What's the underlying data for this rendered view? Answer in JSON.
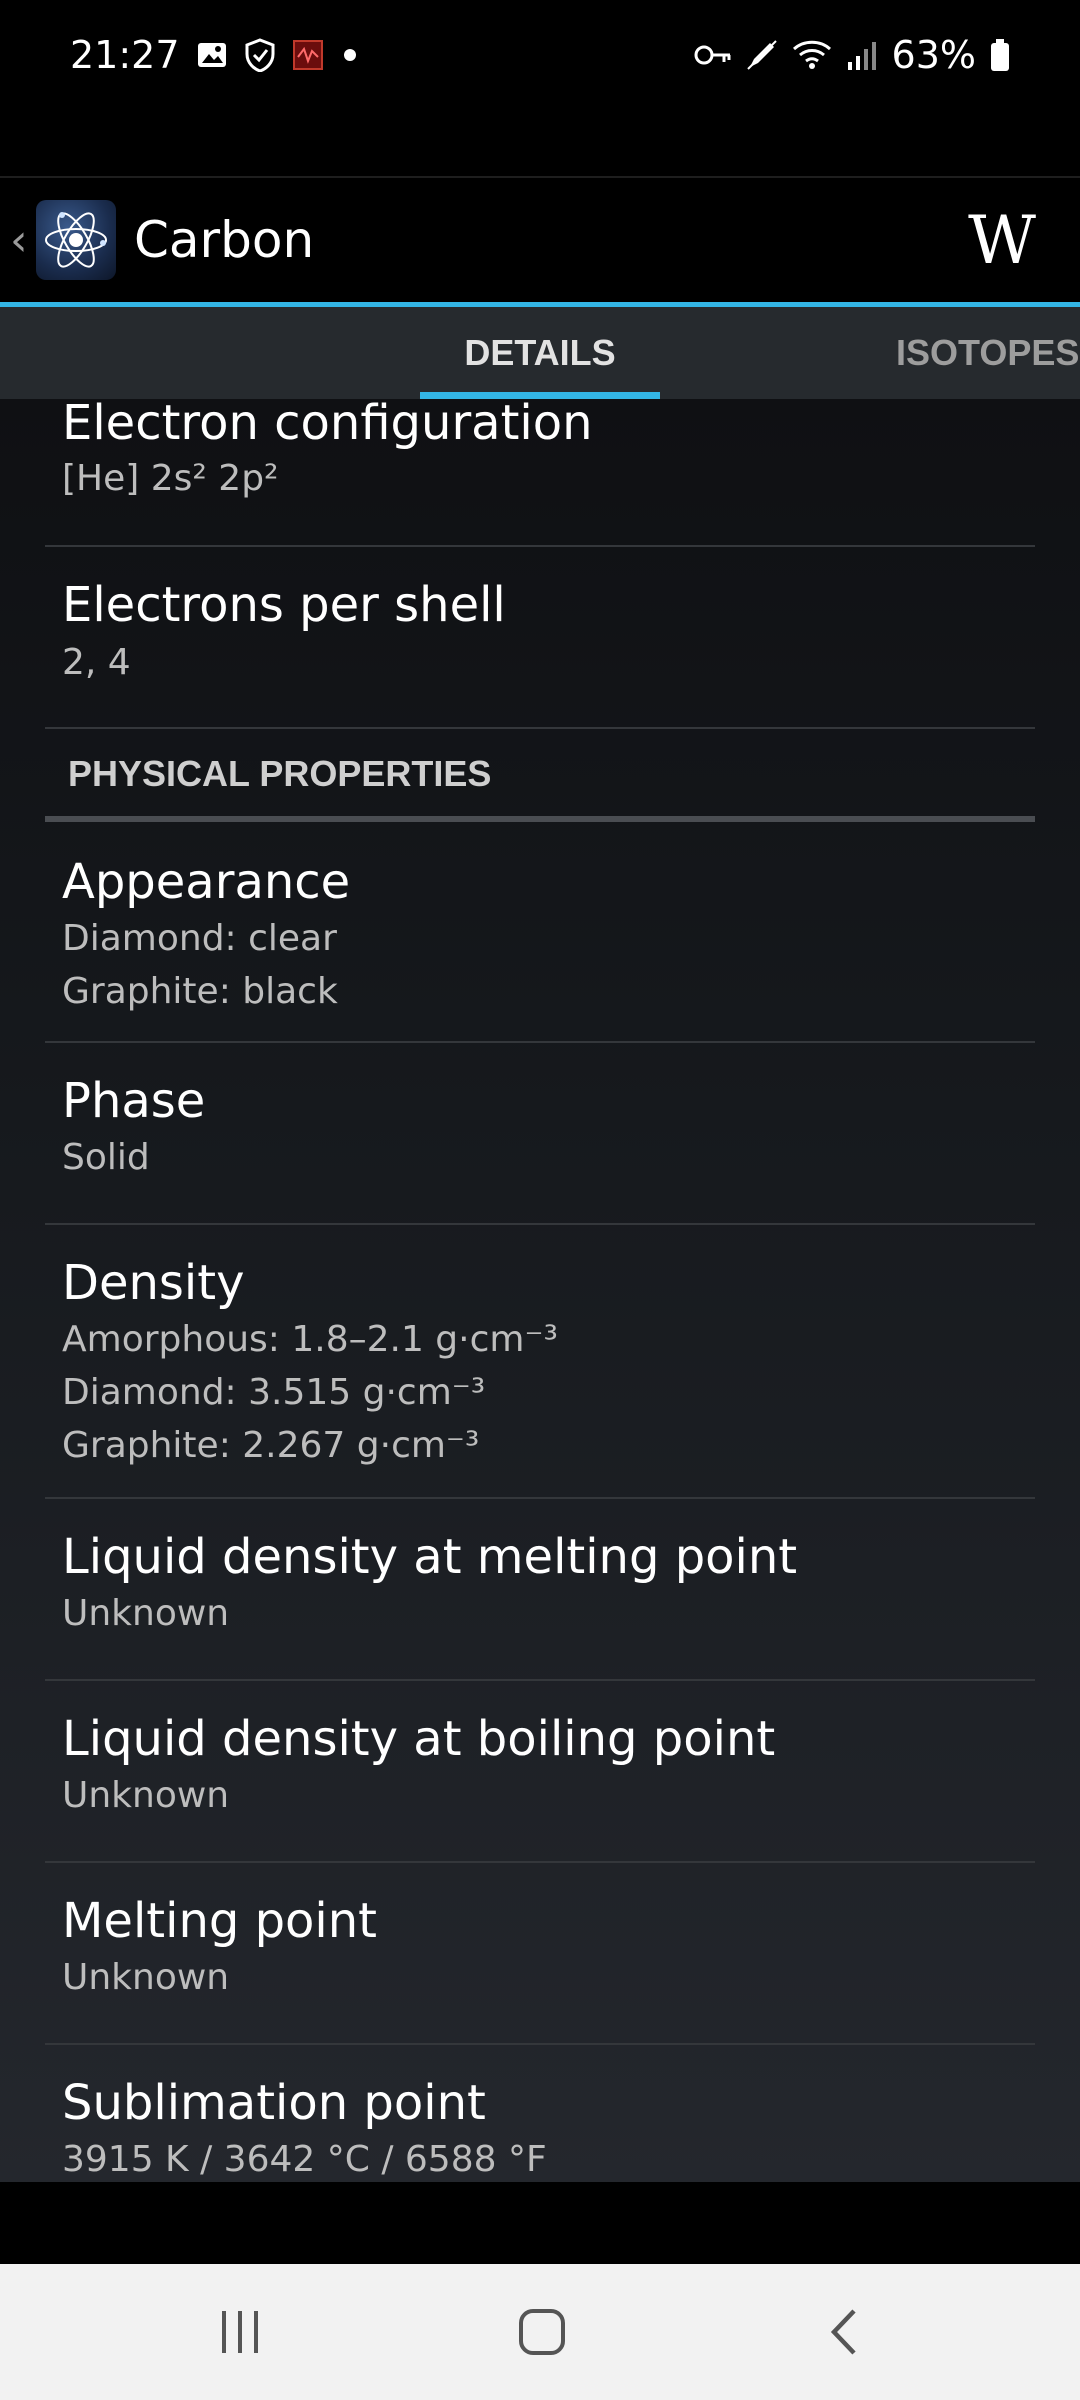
{
  "status_bar": {
    "time": "21:27",
    "battery_percent": "63%",
    "left_icons": [
      "image-icon",
      "shield-icon",
      "red-app-icon",
      "dot-icon"
    ],
    "right_icons": [
      "key-icon",
      "pen-icon",
      "wifi-icon",
      "signal-icon",
      "battery-icon"
    ]
  },
  "app_bar": {
    "title": "Carbon",
    "wiki_label": "W"
  },
  "tabs": [
    {
      "label": "DETAILS",
      "selected": true
    },
    {
      "label": "ISOTOPES",
      "selected": false
    }
  ],
  "rows_top": [
    {
      "title": "Electron configuration",
      "values": [
        "[He] 2s² 2p²"
      ]
    },
    {
      "title": "Electrons per shell",
      "values": [
        "2, 4"
      ]
    }
  ],
  "section": {
    "label": "PHYSICAL PROPERTIES"
  },
  "rows": [
    {
      "title": "Appearance",
      "values": [
        "Diamond: clear",
        "Graphite: black"
      ]
    },
    {
      "title": "Phase",
      "values": [
        "Solid"
      ]
    },
    {
      "title": "Density",
      "values": [
        "Amorphous: 1.8–2.1 g·cm⁻³",
        "Diamond: 3.515 g·cm⁻³",
        "Graphite: 2.267 g·cm⁻³"
      ]
    },
    {
      "title": "Liquid density at melting point",
      "values": [
        "Unknown"
      ]
    },
    {
      "title": "Liquid density at boiling point",
      "values": [
        "Unknown"
      ]
    },
    {
      "title": "Melting point",
      "values": [
        "Unknown"
      ]
    },
    {
      "title": "Sublimation point",
      "values": [
        "3915 K / 3642 °C / 6588 °F"
      ]
    }
  ],
  "nav_bar": {
    "buttons": [
      "recents-icon",
      "home-icon",
      "back-icon"
    ]
  },
  "colors": {
    "accent": "#33b5e5",
    "background": "#000000",
    "tab_bar": "#262a2e",
    "value_text": "#bdbdbd"
  }
}
